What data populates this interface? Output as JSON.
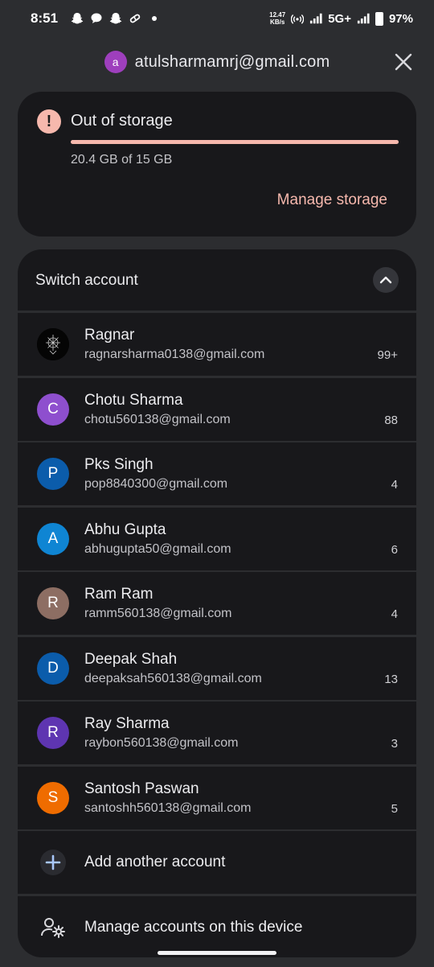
{
  "status_bar": {
    "time": "8:51",
    "net_speed_value": "12.47",
    "net_speed_unit": "KB/s",
    "network": "5G+",
    "battery": "97%",
    "icons": [
      "snapchat-icon",
      "chat-icon",
      "snapchat-icon",
      "pills-icon",
      "dot-icon",
      "hotspot-icon",
      "signal-icon",
      "signal-icon",
      "battery-icon"
    ]
  },
  "header": {
    "avatar_letter": "a",
    "avatar_color": "#9e3fbd",
    "email": "atulsharmamrj@gmail.com"
  },
  "storage": {
    "title": "Out of storage",
    "usage": "20.4 GB of 15 GB",
    "fill_fraction": 1.0,
    "manage_label": "Manage storage",
    "accent_color": "#f6b8ad"
  },
  "switch_account": {
    "title": "Switch account",
    "accounts": [
      {
        "name": "Ragnar",
        "email": "ragnarsharma0138@gmail.com",
        "count": "99+",
        "letter": "",
        "color": "#000000"
      },
      {
        "name": "Chotu Sharma",
        "email": "chotu560138@gmail.com",
        "count": "88",
        "letter": "C",
        "color": "#8e4fce"
      },
      {
        "name": "Pks Singh",
        "email": "pop8840300@gmail.com",
        "count": "4",
        "letter": "P",
        "color": "#0b5cab"
      },
      {
        "name": "Abhu Gupta",
        "email": "abhugupta50@gmail.com",
        "count": "6",
        "letter": "A",
        "color": "#0f85d3"
      },
      {
        "name": "Ram Ram",
        "email": "ramm560138@gmail.com",
        "count": "4",
        "letter": "R",
        "color": "#8d6e63"
      },
      {
        "name": "Deepak Shah",
        "email": "deepaksah560138@gmail.com",
        "count": "13",
        "letter": "D",
        "color": "#0b5cab"
      },
      {
        "name": "Ray Sharma",
        "email": "raybon560138@gmail.com",
        "count": "3",
        "letter": "R",
        "color": "#5e35b1"
      },
      {
        "name": "Santosh Paswan",
        "email": "santoshh560138@gmail.com",
        "count": "5",
        "letter": "S",
        "color": "#ef6c00"
      }
    ],
    "add_account_label": "Add another account",
    "manage_accounts_label": "Manage accounts on this device"
  }
}
